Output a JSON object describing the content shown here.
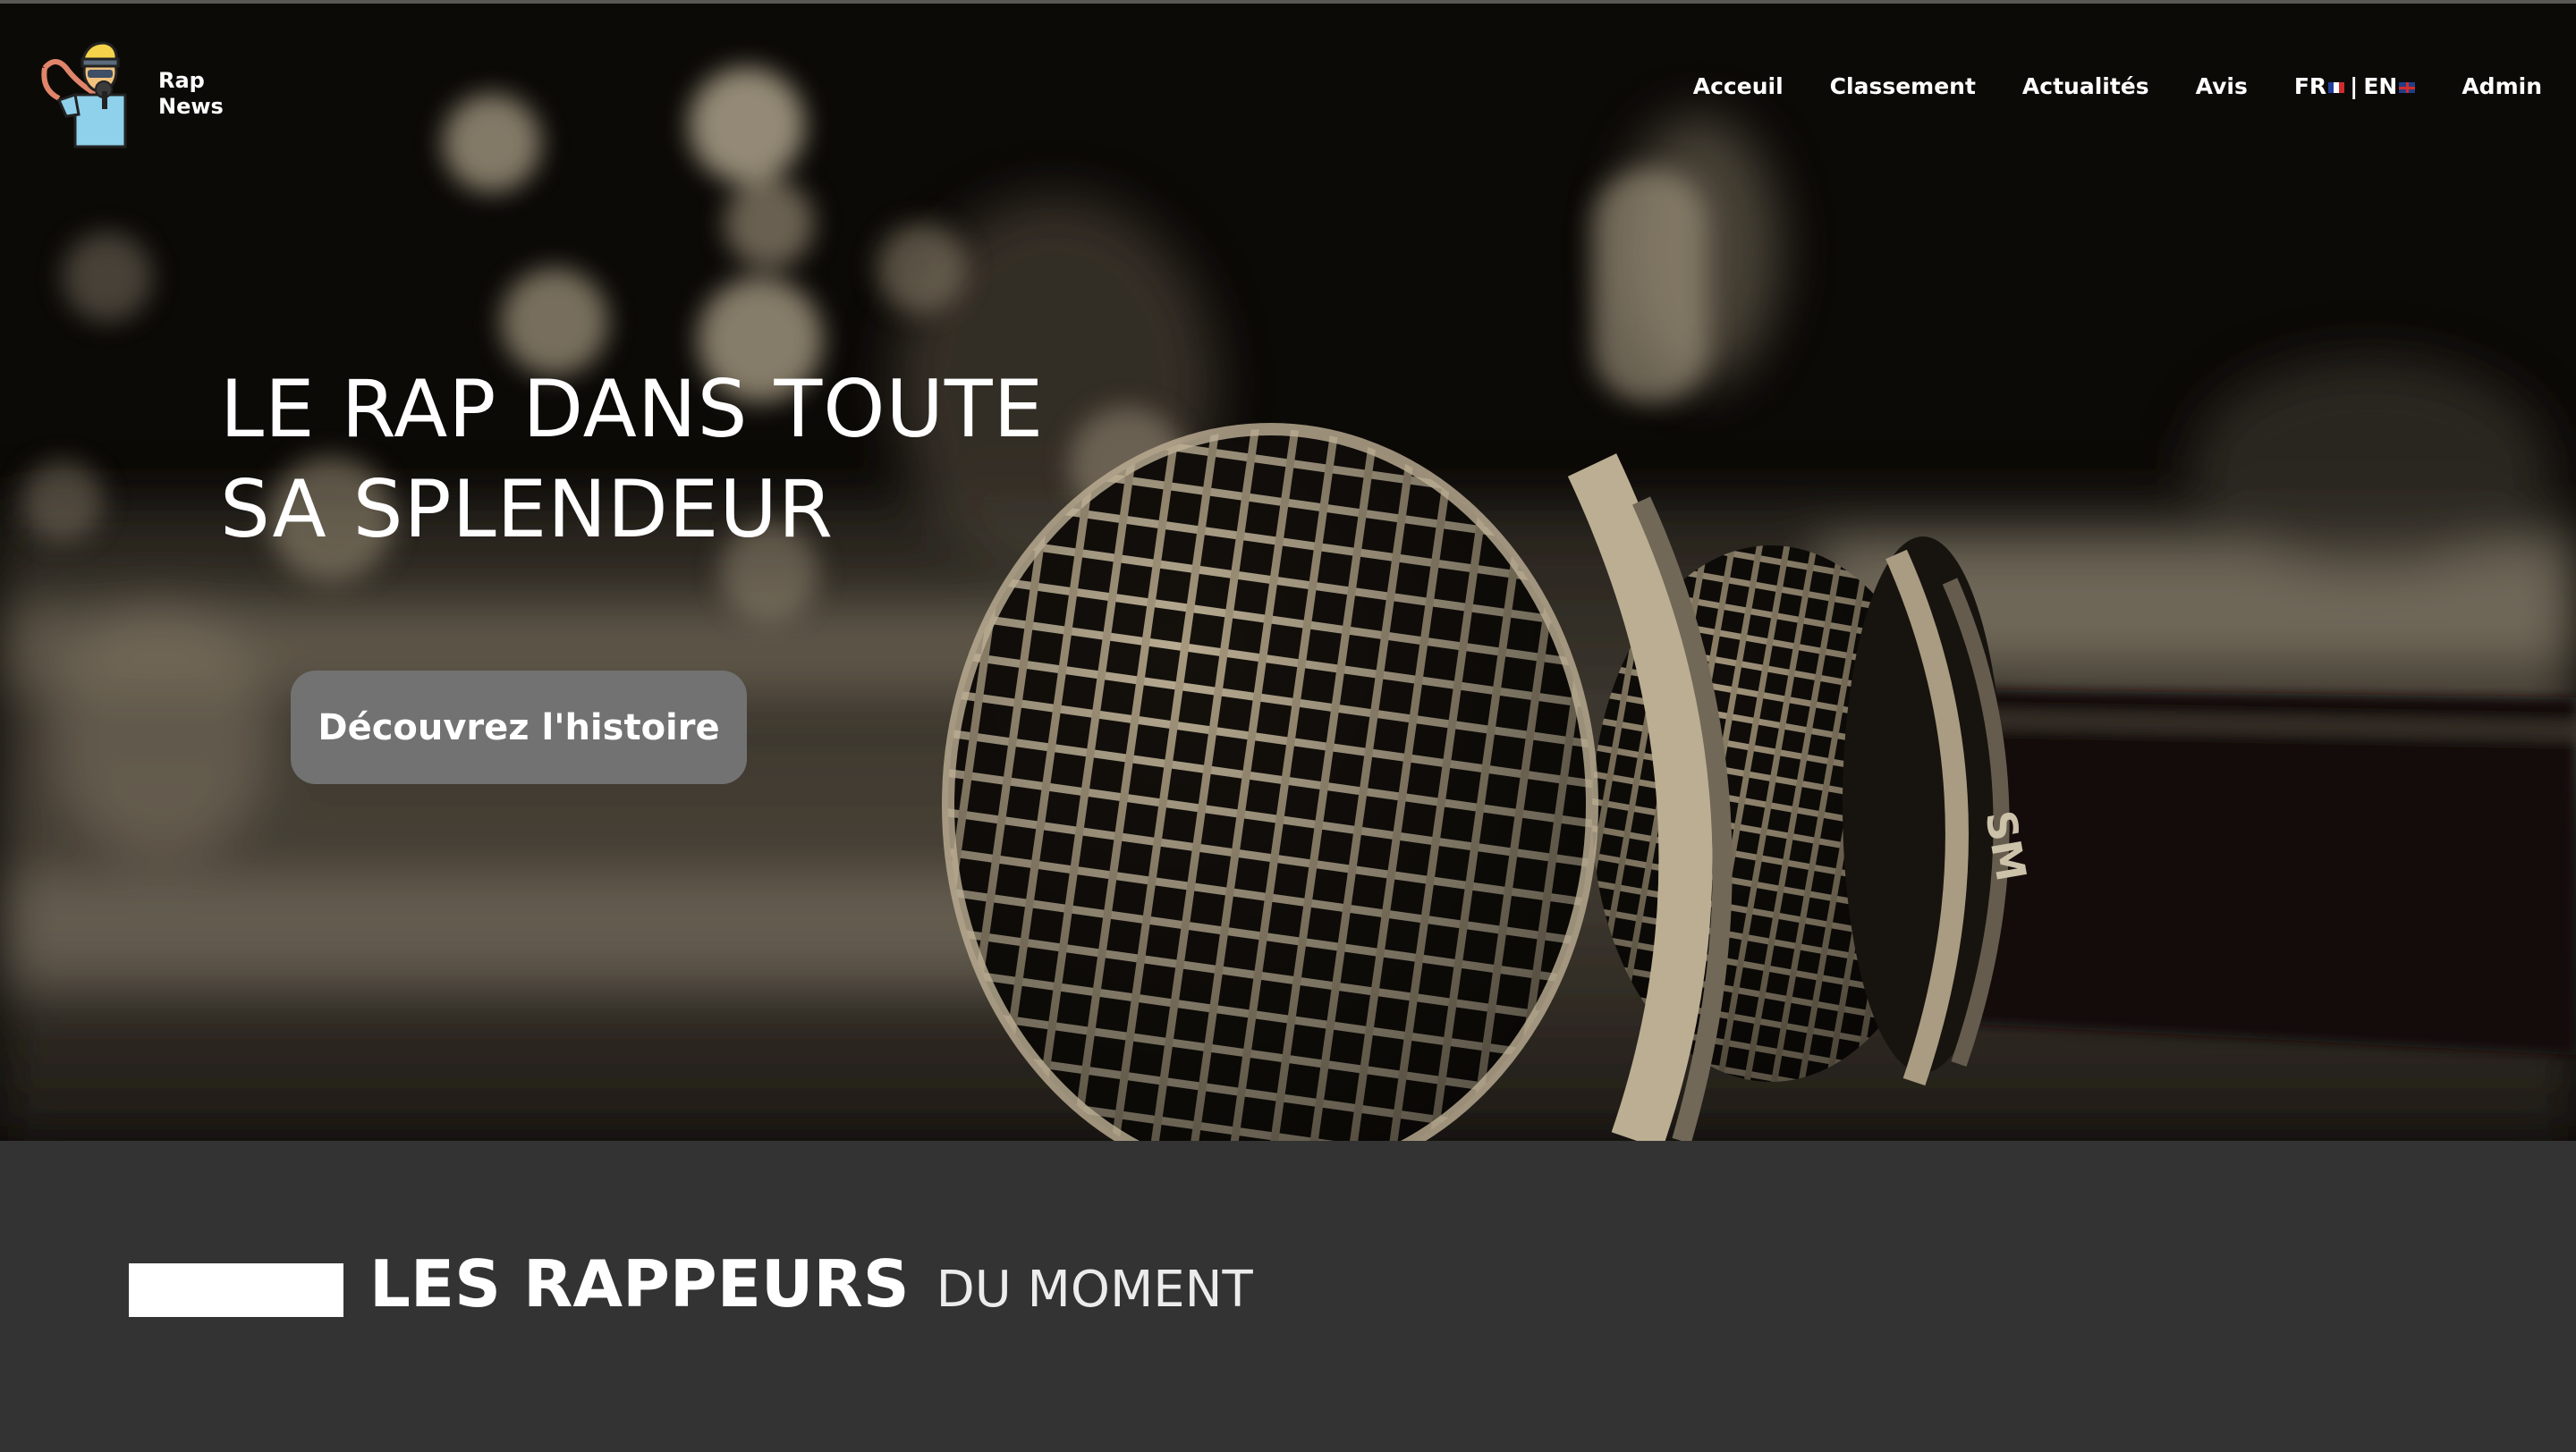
{
  "brand": {
    "name_line1": "Rap",
    "name_line2": "News"
  },
  "nav": {
    "items": [
      "Acceuil",
      "Classement",
      "Actualités",
      "Avis"
    ],
    "lang_fr": "FR",
    "lang_separator": "|",
    "lang_en": "EN",
    "admin": "Admin"
  },
  "hero": {
    "title_line1": "LE RAP DANS TOUTE",
    "title_line2": "SA SPLENDEUR",
    "cta_label": "Découvrez l'histoire",
    "image_icon": "microphone-photo"
  },
  "section": {
    "title_strong": "LES RAPPEURS",
    "title_light": "DU MOMENT"
  },
  "colors": {
    "section_bg": "#333333",
    "cta_bg": "#727272",
    "text": "#ffffff"
  }
}
